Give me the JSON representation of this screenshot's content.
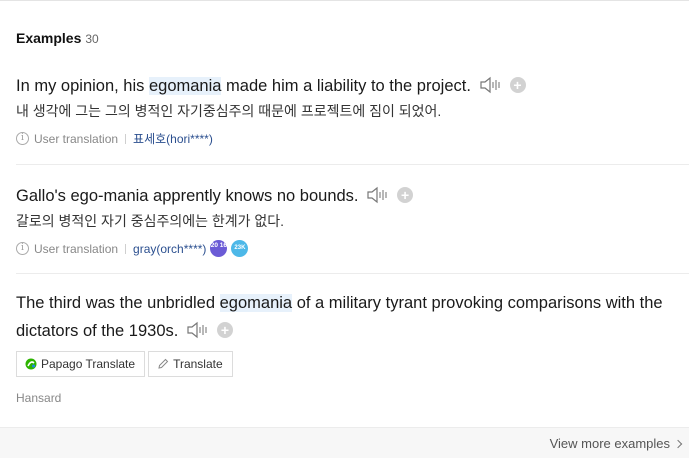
{
  "header": {
    "title": "Examples",
    "count": "30"
  },
  "examples": [
    {
      "en_pre": "In my opinion, his ",
      "en_hl": "egomania",
      "en_post": " made him a liability to the project.",
      "ko": "내 생각에 그는 그의 병적인 자기중심주의 때문에 프로젝트에 짐이 되었어.",
      "meta_label": "User translation",
      "user": "표세호(hori****)"
    },
    {
      "en_pre": "Gallo's ego-mania apprently knows no bounds.",
      "en_hl": "",
      "en_post": "",
      "ko": "갈로의 병적인 자기 중심주의에는 한계가 없다.",
      "meta_label": "User translation",
      "user": "gray(orch****)",
      "badge1": "20 16",
      "badge2": "23K"
    },
    {
      "en_pre": "The third was the unbridled ",
      "en_hl": "egomania",
      "en_post": " of a military tyrant provoking comparisons with the dictators of the 1930s.",
      "papago_label": "Papago Translate",
      "translate_label": "Translate",
      "source": "Hansard"
    }
  ],
  "footer": {
    "view_more": "View more examples"
  },
  "icons": {
    "sound": "speaker-icon",
    "add": "plus-icon",
    "info": "info-icon",
    "papago": "papago-icon",
    "pencil": "pencil-icon",
    "chevron": "chevron-right-icon"
  },
  "colors": {
    "highlight": "#e7f1fb",
    "user_link": "#2b4f8f",
    "badge_purple": "#6b5bd6",
    "badge_blue": "#4db8e8"
  }
}
